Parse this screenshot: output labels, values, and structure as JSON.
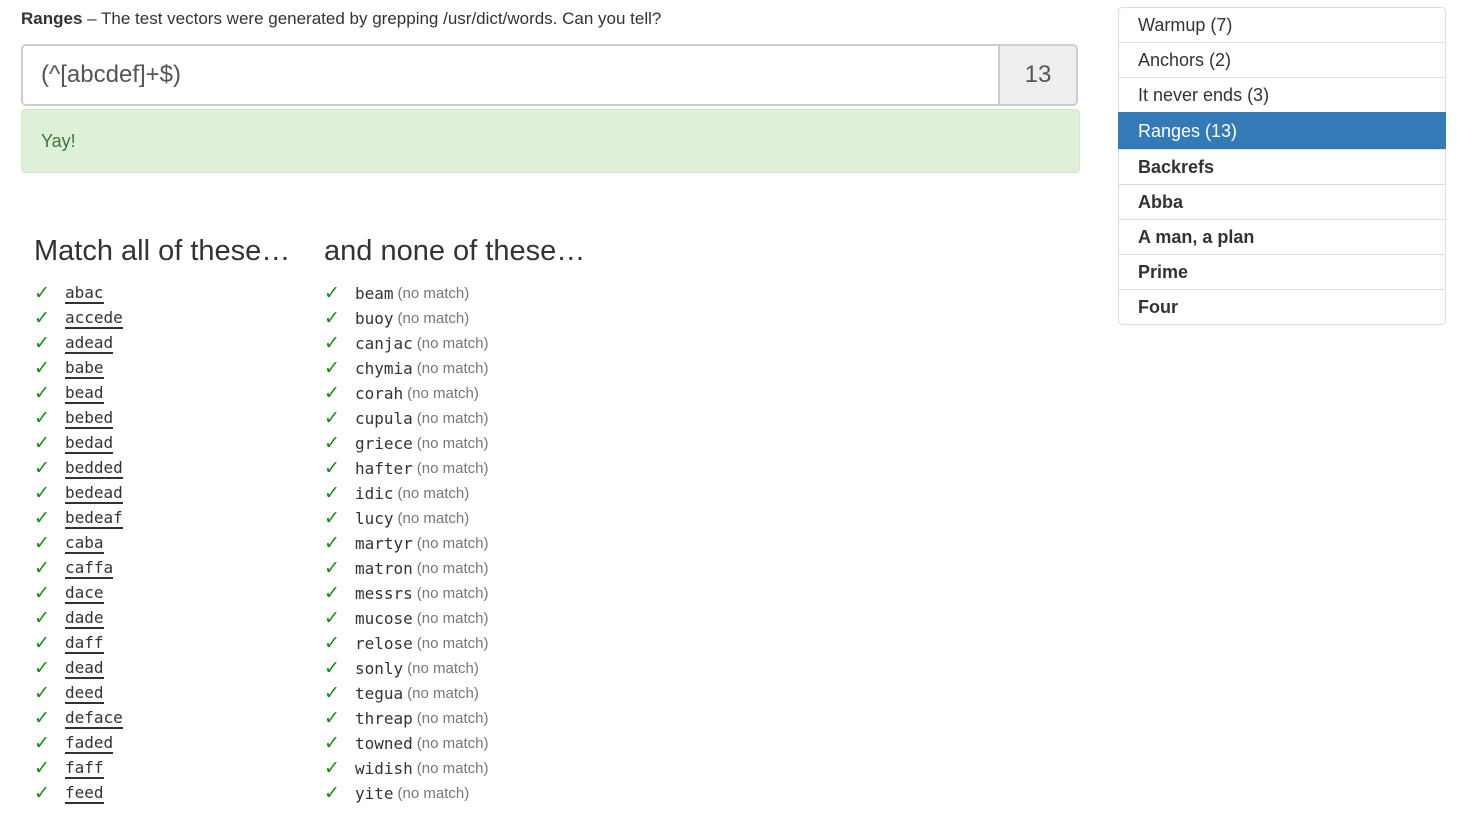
{
  "header": {
    "level_name": "Ranges",
    "description": " – The test vectors were generated by grepping /usr/dict/words. Can you tell?"
  },
  "regex": {
    "value": "(^[abcdef]+$)",
    "score": "13"
  },
  "alert": {
    "text": "Yay!"
  },
  "match_column": {
    "title": "Match all of these…",
    "items": [
      "abac",
      "accede",
      "adead",
      "babe",
      "bead",
      "bebed",
      "bedad",
      "bedded",
      "bedead",
      "bedeaf",
      "caba",
      "caffa",
      "dace",
      "dade",
      "daff",
      "dead",
      "deed",
      "deface",
      "faded",
      "faff",
      "feed"
    ]
  },
  "nomatch_column": {
    "title": "and none of these…",
    "note": "(no match)",
    "items": [
      "beam",
      "buoy",
      "canjac",
      "chymia",
      "corah",
      "cupula",
      "griece",
      "hafter",
      "idic",
      "lucy",
      "martyr",
      "matron",
      "messrs",
      "mucose",
      "relose",
      "sonly",
      "tegua",
      "threap",
      "towned",
      "widish",
      "yite"
    ]
  },
  "check_glyph": "✓",
  "colors": {
    "check": "#1b8a1b",
    "active": "#337ab7",
    "alert_bg": "#dff0d8",
    "alert_text": "#3c763d"
  },
  "levels": [
    {
      "label": "Warmup (7)",
      "state": "done"
    },
    {
      "label": "Anchors (2)",
      "state": "done"
    },
    {
      "label": "It never ends (3)",
      "state": "done"
    },
    {
      "label": "Ranges (13)",
      "state": "active"
    },
    {
      "label": "Backrefs",
      "state": "locked"
    },
    {
      "label": "Abba",
      "state": "locked"
    },
    {
      "label": "A man, a plan",
      "state": "locked"
    },
    {
      "label": "Prime",
      "state": "locked"
    },
    {
      "label": "Four",
      "state": "locked"
    }
  ]
}
